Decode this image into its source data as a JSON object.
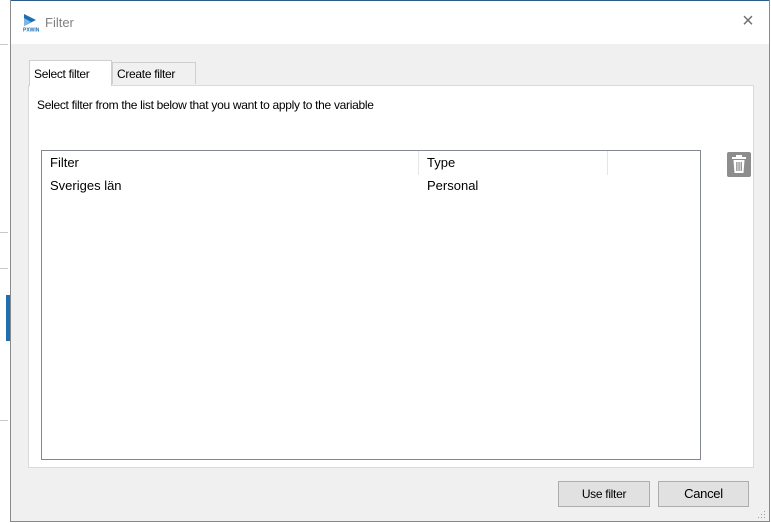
{
  "window": {
    "title": "Filter",
    "close_glyph": "×"
  },
  "app_icon": {
    "name": "pxwin-logo-icon",
    "text": "PXWIN",
    "color": "#1a6fb5"
  },
  "tabs": [
    {
      "label": "Select filter",
      "active": true
    },
    {
      "label": "Create filter",
      "active": false
    }
  ],
  "panel": {
    "instruction": "Select filter from the list below that you want to apply to the variable"
  },
  "list": {
    "columns": [
      "Filter",
      "Type"
    ],
    "rows": [
      {
        "filter": "Sveriges län",
        "type": "Personal"
      }
    ]
  },
  "buttons": {
    "use_filter": "Use filter",
    "cancel": "Cancel"
  },
  "icons": {
    "delete": "trash-icon"
  },
  "colors": {
    "dialog_bg": "#f0f0f0",
    "button_bg": "#e1e1e1",
    "trash_bg": "#8d8d8d",
    "accent": "#1f6fb0"
  }
}
